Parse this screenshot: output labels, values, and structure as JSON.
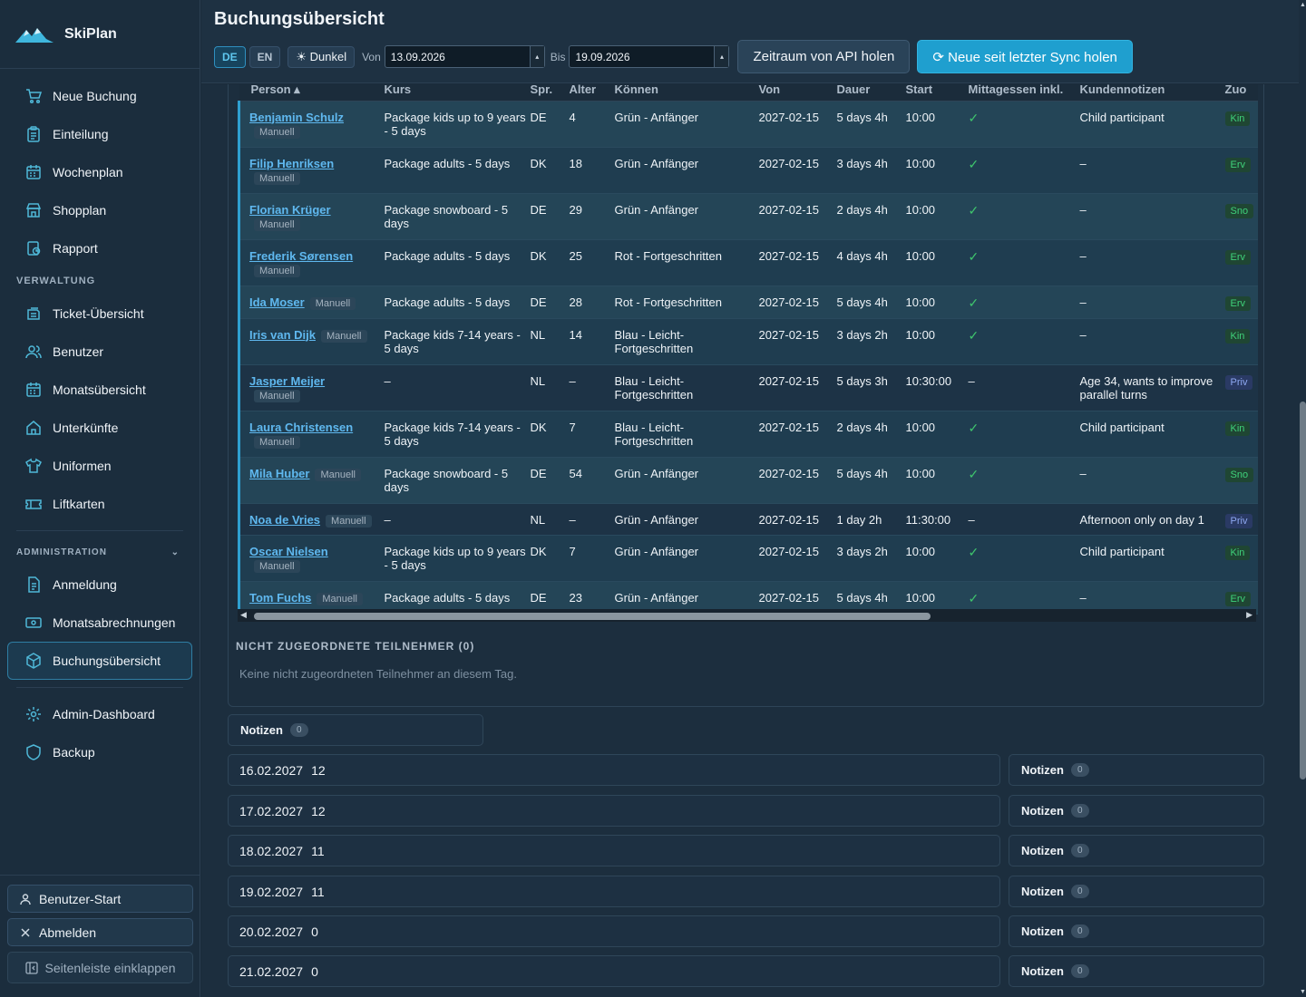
{
  "app": {
    "name": "SkiPlan"
  },
  "sidebar": {
    "items": [
      {
        "label": "Neue Buchung",
        "icon": "cart-icon"
      },
      {
        "label": "Einteilung",
        "icon": "clipboard-icon"
      },
      {
        "label": "Wochenplan",
        "icon": "calendar-icon"
      },
      {
        "label": "Shopplan",
        "icon": "store-icon"
      },
      {
        "label": "Rapport",
        "icon": "report-icon"
      }
    ],
    "verwaltung_label": "VERWALTUNG",
    "verwaltung_items": [
      {
        "label": "Ticket-Übersicht",
        "icon": "ticket-icon"
      },
      {
        "label": "Benutzer",
        "icon": "users-icon"
      },
      {
        "label": "Monatsübersicht",
        "icon": "calendar-icon"
      },
      {
        "label": "Unterkünfte",
        "icon": "home-icon"
      },
      {
        "label": "Uniformen",
        "icon": "shirt-icon"
      },
      {
        "label": "Liftkarten",
        "icon": "ticket-card-icon"
      }
    ],
    "admin_label": "ADMINISTRATION",
    "admin_items": [
      {
        "label": "Anmeldung",
        "icon": "document-icon"
      },
      {
        "label": "Monatsabrechnungen",
        "icon": "money-icon"
      },
      {
        "label": "Buchungsübersicht",
        "icon": "box-icon",
        "active": true
      }
    ],
    "extra_items": [
      {
        "label": "Admin-Dashboard",
        "icon": "gear-icon"
      },
      {
        "label": "Backup",
        "icon": "shield-icon"
      }
    ],
    "bottom": {
      "user_start": "Benutzer-Start",
      "logout": "Abmelden",
      "collapse": "Seitenleiste einklappen"
    }
  },
  "header": {
    "title": "Buchungsübersicht",
    "lang_de": "DE",
    "lang_en": "EN",
    "theme": "☀ Dunkel",
    "from_label": "Von",
    "from_value": "13.09.2026",
    "to_label": "Bis",
    "to_value": "19.09.2026",
    "api_button": "Zeitraum von API holen",
    "sync_button": "⟳ Neue seit letzter Sync holen"
  },
  "table": {
    "columns": [
      "Person ▴",
      "Kurs",
      "Spr.",
      "Alter",
      "Können",
      "Von",
      "Dauer",
      "Start",
      "Mittagessen inkl.",
      "Kundennotizen",
      "Zuo"
    ],
    "rows": [
      {
        "person": "Benjamin Schulz",
        "tag": "Manuell",
        "kurs": "Package kids up to 9 years - 5 days",
        "spr": "DE",
        "alter": "4",
        "koennen": "Grün - Anfänger",
        "von": "2027-02-15",
        "dauer": "5 days 4h",
        "start": "10:00",
        "lunch": "✓",
        "notes": "Child participant",
        "zuo": "Kin"
      },
      {
        "person": "Filip Henriksen",
        "tag": "Manuell",
        "kurs": "Package adults - 5 days",
        "spr": "DK",
        "alter": "18",
        "koennen": "Grün - Anfänger",
        "von": "2027-02-15",
        "dauer": "3 days 4h",
        "start": "10:00",
        "lunch": "✓",
        "notes": "–",
        "zuo": "Erv"
      },
      {
        "person": "Florian Krüger",
        "tag": "Manuell",
        "kurs": "Package snowboard - 5 days",
        "spr": "DE",
        "alter": "29",
        "koennen": "Grün - Anfänger",
        "von": "2027-02-15",
        "dauer": "2 days 4h",
        "start": "10:00",
        "lunch": "✓",
        "notes": "–",
        "zuo": "Sno"
      },
      {
        "person": "Frederik Sørensen",
        "tag": "Manuell",
        "kurs": "Package adults - 5 days",
        "spr": "DK",
        "alter": "25",
        "koennen": "Rot - Fortgeschritten",
        "von": "2027-02-15",
        "dauer": "4 days 4h",
        "start": "10:00",
        "lunch": "✓",
        "notes": "–",
        "zuo": "Erv"
      },
      {
        "person": "Ida Moser",
        "tag": "Manuell",
        "kurs": "Package adults - 5 days",
        "spr": "DE",
        "alter": "28",
        "koennen": "Rot - Fortgeschritten",
        "von": "2027-02-15",
        "dauer": "5 days 4h",
        "start": "10:00",
        "lunch": "✓",
        "notes": "–",
        "zuo": "Erv"
      },
      {
        "person": "Iris van Dijk",
        "tag": "Manuell",
        "kurs": "Package kids 7-14 years - 5 days",
        "spr": "NL",
        "alter": "14",
        "koennen": "Blau - Leicht-Fortgeschritten",
        "von": "2027-02-15",
        "dauer": "3 days 2h",
        "start": "10:00",
        "lunch": "✓",
        "notes": "–",
        "zuo": "Kin"
      },
      {
        "person": "Jasper Meijer",
        "tag": "Manuell",
        "kurs": "–",
        "spr": "NL",
        "alter": "–",
        "koennen": "Blau - Leicht-Fortgeschritten",
        "von": "2027-02-15",
        "dauer": "5 days 3h",
        "start": "10:30:00",
        "lunch": "–",
        "notes": "Age 34, wants to improve parallel turns",
        "zuo": "Priv"
      },
      {
        "person": "Laura Christensen",
        "tag": "Manuell",
        "kurs": "Package kids 7-14 years - 5 days",
        "spr": "DK",
        "alter": "7",
        "koennen": "Blau - Leicht-Fortgeschritten",
        "von": "2027-02-15",
        "dauer": "2 days 4h",
        "start": "10:00",
        "lunch": "✓",
        "notes": "Child participant",
        "zuo": "Kin"
      },
      {
        "person": "Mila Huber",
        "tag": "Manuell",
        "kurs": "Package snowboard - 5 days",
        "spr": "DE",
        "alter": "54",
        "koennen": "Grün - Anfänger",
        "von": "2027-02-15",
        "dauer": "5 days 4h",
        "start": "10:00",
        "lunch": "✓",
        "notes": "–",
        "zuo": "Sno"
      },
      {
        "person": "Noa de Vries",
        "tag": "Manuell",
        "kurs": "–",
        "spr": "NL",
        "alter": "–",
        "koennen": "Grün - Anfänger",
        "von": "2027-02-15",
        "dauer": "1 day 2h",
        "start": "11:30:00",
        "lunch": "–",
        "notes": "Afternoon only on day 1",
        "zuo": "Priv"
      },
      {
        "person": "Oscar Nielsen",
        "tag": "Manuell",
        "kurs": "Package kids up to 9 years - 5 days",
        "spr": "DK",
        "alter": "7",
        "koennen": "Grün - Anfänger",
        "von": "2027-02-15",
        "dauer": "3 days 2h",
        "start": "10:00",
        "lunch": "✓",
        "notes": "Child participant",
        "zuo": "Kin"
      },
      {
        "person": "Tom Fuchs",
        "tag": "Manuell",
        "kurs": "Package adults - 5 days",
        "spr": "DE",
        "alter": "23",
        "koennen": "Grün - Anfänger",
        "von": "2027-02-15",
        "dauer": "5 days 4h",
        "start": "10:00",
        "lunch": "✓",
        "notes": "–",
        "zuo": "Erv"
      }
    ]
  },
  "unassigned": {
    "title": "NICHT ZUGEORDNETE TEILNEHMER (0)",
    "empty_text": "Keine nicht zugeordneten Teilnehmer an diesem Tag."
  },
  "notes": {
    "label": "Notizen",
    "count": "0"
  },
  "days": [
    {
      "date": "16.02.2027",
      "count": "12",
      "notes_label": "Notizen",
      "notes_count": "0"
    },
    {
      "date": "17.02.2027",
      "count": "12",
      "notes_label": "Notizen",
      "notes_count": "0"
    },
    {
      "date": "18.02.2027",
      "count": "11",
      "notes_label": "Notizen",
      "notes_count": "0"
    },
    {
      "date": "19.02.2027",
      "count": "11",
      "notes_label": "Notizen",
      "notes_count": "0"
    },
    {
      "date": "20.02.2027",
      "count": "0",
      "notes_label": "Notizen",
      "notes_count": "0"
    },
    {
      "date": "21.02.2027",
      "count": "0",
      "notes_label": "Notizen",
      "notes_count": "0"
    }
  ],
  "colors": {
    "accent": "#1f9fcf",
    "link": "#5fb8ef",
    "check": "#3fc56d",
    "bg": "#1c2e3e"
  }
}
